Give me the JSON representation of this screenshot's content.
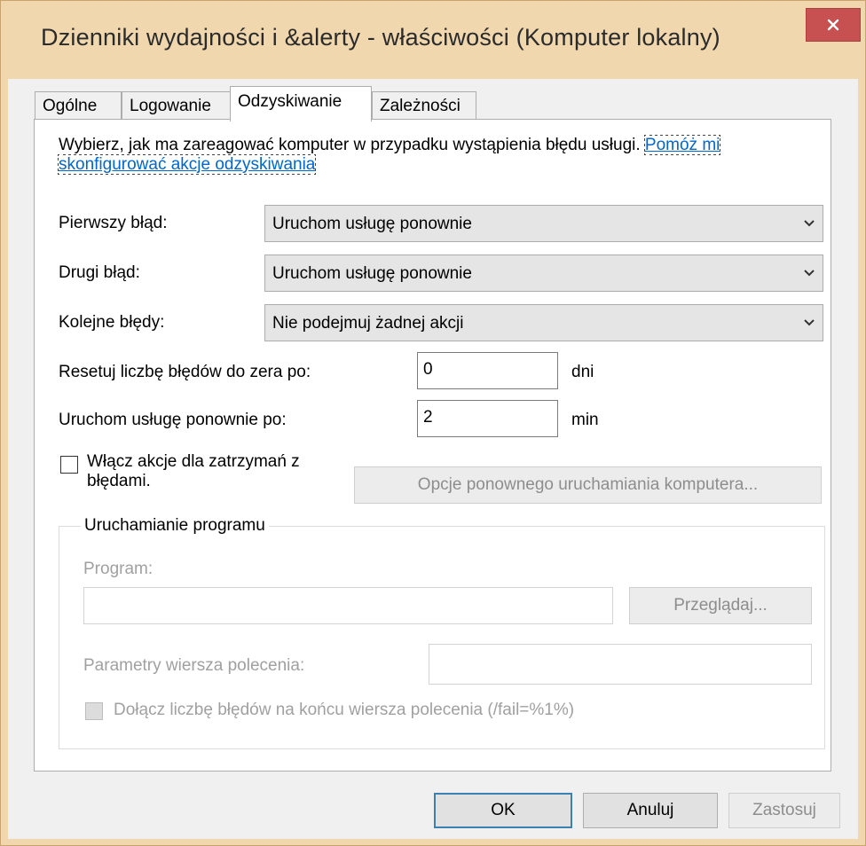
{
  "window": {
    "title": "Dzienniki wydajności i &alerty - właściwości (Komputer lokalny)",
    "close_icon": "close-icon",
    "accent": "#c75050"
  },
  "tabs": [
    {
      "label": "Ogólne",
      "active": false
    },
    {
      "label": "Logowanie",
      "active": false
    },
    {
      "label": "Odzyskiwanie",
      "active": true
    },
    {
      "label": "Zależności",
      "active": false
    }
  ],
  "recovery": {
    "description": "Wybierz, jak ma zareagować komputer w przypadku wystąpienia błędu usługi.",
    "help_link": "Pomóż mi skonfigurować akcje odzyskiwania",
    "first_failure_label": "Pierwszy błąd:",
    "first_failure_value": "Uruchom usługę ponownie",
    "second_failure_label": "Drugi błąd:",
    "second_failure_value": "Uruchom usługę ponownie",
    "subsequent_label": "Kolejne błędy:",
    "subsequent_value": "Nie podejmuj żadnej akcji",
    "reset_label": "Resetuj liczbę błędów do zera po:",
    "reset_value": "0",
    "reset_unit": "dni",
    "restart_label": "Uruchom usługę ponownie po:",
    "restart_value": "2",
    "restart_unit": "min",
    "enable_actions_label": "Włącz akcje dla zatrzymań z błędami.",
    "restart_options_button": "Opcje ponownego uruchamiania komputera..."
  },
  "program_group": {
    "title": "Uruchamianie programu",
    "program_label": "Program:",
    "program_value": "",
    "browse_button": "Przeglądaj...",
    "params_label": "Parametry wiersza polecenia:",
    "params_value": "",
    "append_label": "Dołącz liczbę błędów na końcu wiersza polecenia (/fail=%1%)"
  },
  "footer": {
    "ok": "OK",
    "cancel": "Anuluj",
    "apply": "Zastosuj"
  }
}
